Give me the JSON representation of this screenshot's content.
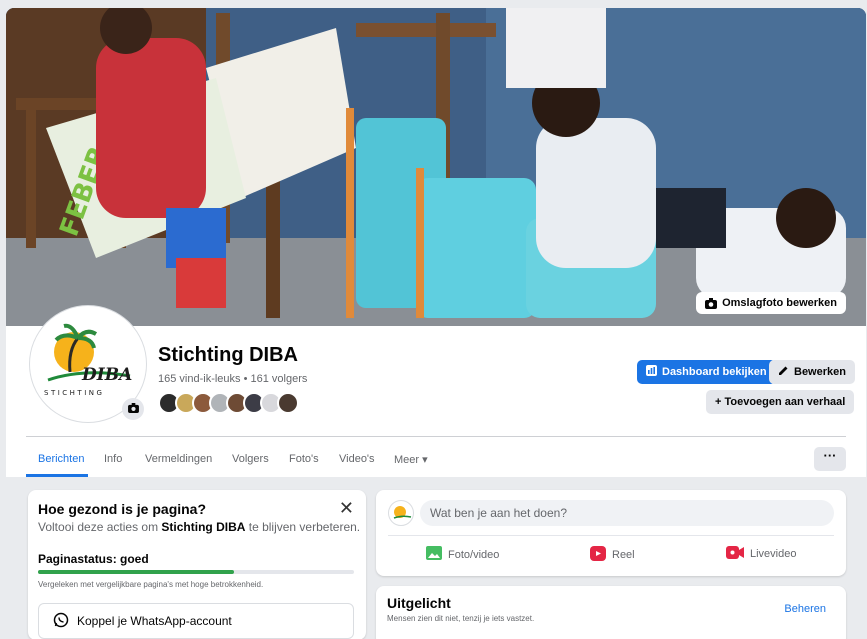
{
  "cover": {
    "edit_label": "Omslagfoto bewerken"
  },
  "logo": {
    "text": "DIBA",
    "subtext": "STICHTING"
  },
  "profile": {
    "name": "Stichting DIBA",
    "stats": "165 vind-ik-leuks • 161 volgers",
    "dashboard_label": "Dashboard bekijken",
    "edit_label": "Bewerken",
    "add_story_label": "+ Toevoegen aan verhaal"
  },
  "tabs": [
    {
      "label": "Berichten"
    },
    {
      "label": "Info"
    },
    {
      "label": "Vermeldingen"
    },
    {
      "label": "Volgers"
    },
    {
      "label": "Foto's"
    },
    {
      "label": "Video's"
    },
    {
      "label": "Meer ▾"
    }
  ],
  "more_label": "···",
  "health": {
    "title": "Hoe gezond is je pagina?",
    "sub_prefix": "Voltooi deze acties om ",
    "sub_bold": "Stichting DIBA",
    "sub_suffix": " te blijven verbeteren.",
    "status": "Paginastatus: goed",
    "progress": 0.62,
    "note": "Vergeleken met vergelijkbare pagina's met hoge betrokkenheid.",
    "whatsapp_label": "Koppel je WhatsApp-account",
    "close_label": "✕"
  },
  "composer": {
    "placeholder": "Wat ben je aan het doen?",
    "actions": [
      {
        "label": "Foto/video",
        "color": "#45bd62"
      },
      {
        "label": "Reel",
        "color": "#e42645"
      },
      {
        "label": "Livevideo",
        "color": "#e42645"
      }
    ]
  },
  "featured": {
    "title": "Uitgelicht",
    "subtitle": "Mensen zien dit niet, tenzij je iets vastzet.",
    "manage_label": "Beheren"
  },
  "colors": {
    "accent": "#1b74e4",
    "progress": "#31a24c"
  }
}
